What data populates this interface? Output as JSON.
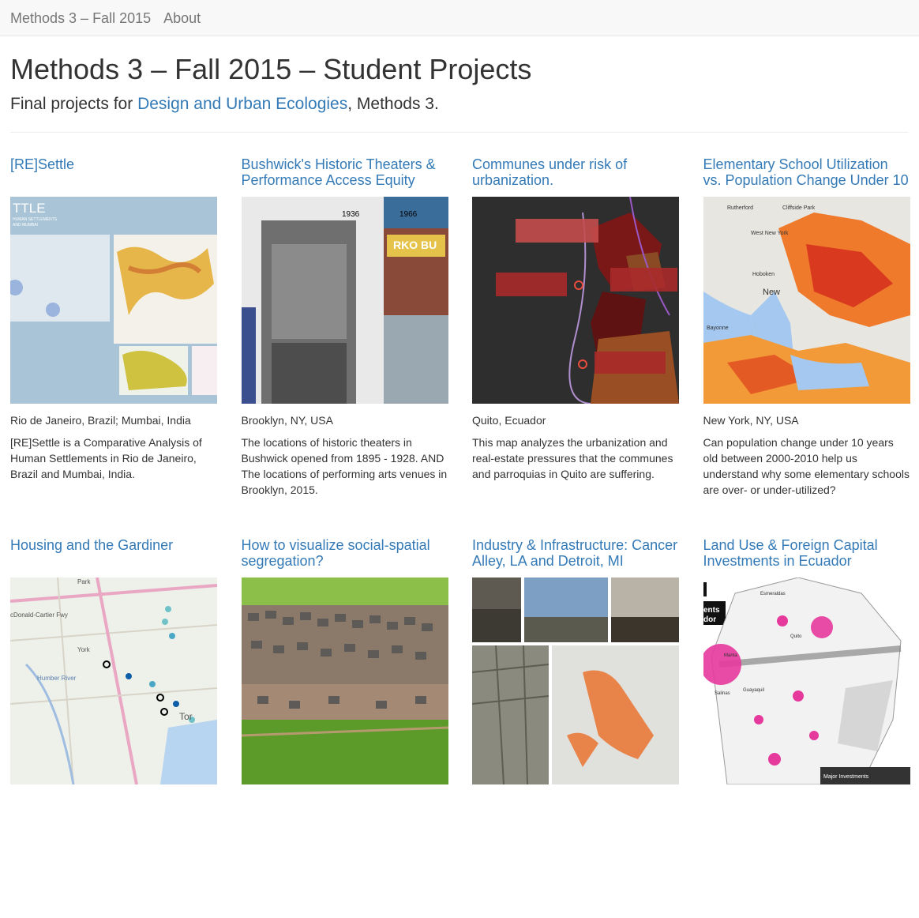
{
  "nav": {
    "brand": "Methods 3 – Fall 2015",
    "about": "About"
  },
  "header": {
    "title": "Methods 3 – Fall 2015 – Student Projects",
    "subtitle_prefix": "Final projects for ",
    "subtitle_link": "Design and Urban Ecologies",
    "subtitle_suffix": ", Methods 3."
  },
  "projects": [
    {
      "title": "[RE]Settle",
      "location": "Rio de Janeiro, Brazil; Mumbai, India",
      "description": "[RE]Settle is a Comparative Analysis of Human Settlements in Rio de Janeiro, Brazil and Mumbai, India.",
      "thumb_text": [
        "TTLE",
        "HUMAN SETTLEMENTS",
        "AND MUMBAI"
      ]
    },
    {
      "title": "Bushwick's Historic Theaters & Performance Access Equity",
      "location": "Brooklyn, NY, USA",
      "description": "The locations of historic theaters in Bushwick opened from 1895 - 1928. AND The locations of performing arts venues in Brooklyn, 2015.",
      "thumb_text": [
        "1936",
        "1966",
        "RKO BU"
      ]
    },
    {
      "title": "Communes under risk of urbanization.",
      "location": "Quito, Ecuador",
      "description": "This map analyzes the urbanization and real-estate pressures that the communes and parroquias in Quito are suffering.",
      "thumb_text": []
    },
    {
      "title": "Elementary School Utilization vs. Population Change Under 10",
      "location": "New York, NY, USA",
      "description": "Can population change under 10 years old between 2000-2010 help us understand why some elementary schools are over- or under-utilized?",
      "thumb_text": [
        "Rutherford",
        "Cliffside Park",
        "West New York",
        "Hoboken",
        "Bayonne",
        "New"
      ]
    },
    {
      "title": "Housing and the Gardiner",
      "location": "",
      "description": "",
      "thumb_text": [
        "Park",
        "cDonald-Cartier Fwy",
        "York",
        "Humber River",
        "Tor"
      ]
    },
    {
      "title": "How to visualize social-spatial segregation?",
      "location": "",
      "description": "",
      "thumb_text": []
    },
    {
      "title": "Industry & Infrastructure: Cancer Alley, LA and Detroit, MI",
      "location": "",
      "description": "",
      "thumb_text": []
    },
    {
      "title": "Land Use & Foreign Capital Investments in Ecuador",
      "location": "",
      "description": "",
      "thumb_text": [
        "ents",
        "dor",
        "Esmeraldas",
        "Quito",
        "Manta",
        "Salinas",
        "Guayaquil",
        "Major Investments"
      ]
    }
  ]
}
